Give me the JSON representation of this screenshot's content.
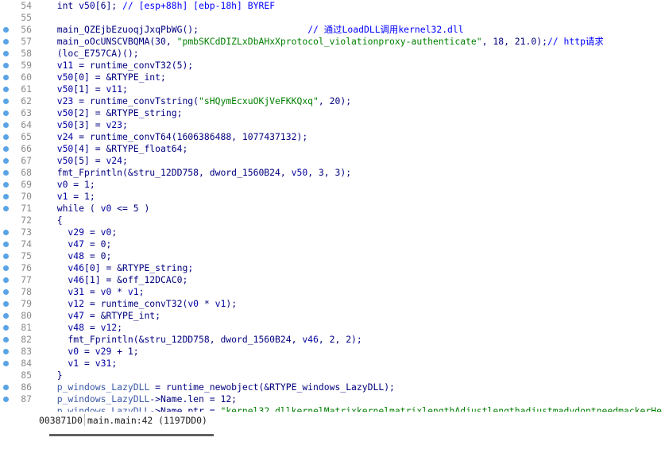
{
  "status_bar": {
    "address": "003871D0",
    "location": "main.main:42 (1197DD0)"
  },
  "colors": {
    "breakpoint": "#5aa4e6",
    "keyword": "#00007f",
    "comment": "#0000ff",
    "string": "#007f00",
    "line_number": "#8a8a8a"
  },
  "code_lines": [
    {
      "num": "54",
      "bp": false,
      "tokens": [
        [
          "kw",
          "  int "
        ],
        [
          "lvar",
          "v50"
        ],
        [
          "sym",
          "[6]; "
        ],
        [
          "cmt",
          "// [esp+88h] [ebp-18h] BYREF"
        ]
      ]
    },
    {
      "num": "55",
      "bp": false,
      "tokens": []
    },
    {
      "num": "56",
      "bp": true,
      "tokens": [
        [
          "fn",
          "  main_QZEjbEzuoqjJxqPbWG"
        ],
        [
          "sym",
          "();                    "
        ],
        [
          "cmt",
          "// 通过LoadDLL调用kernel32.dll"
        ]
      ]
    },
    {
      "num": "57",
      "bp": true,
      "tokens": [
        [
          "fn",
          "  main_oOcUNSCVBQMA"
        ],
        [
          "sym",
          "(30, "
        ],
        [
          "str",
          "\"pmbSKCdDIZLxDbAHxXprotocol_violationproxy-authenticate\""
        ],
        [
          "sym",
          ", 18, 21.0);"
        ],
        [
          "cmt",
          "// http请求"
        ]
      ]
    },
    {
      "num": "58",
      "bp": true,
      "tokens": [
        [
          "sym",
          "  (loc_E757CA)();"
        ]
      ]
    },
    {
      "num": "59",
      "bp": true,
      "tokens": [
        [
          "lvar",
          "  v11"
        ],
        [
          "sym",
          " = runtime_convT32(5);"
        ]
      ]
    },
    {
      "num": "60",
      "bp": true,
      "tokens": [
        [
          "lvar",
          "  v50"
        ],
        [
          "sym",
          "[0] = &RTYPE_int;"
        ]
      ]
    },
    {
      "num": "61",
      "bp": true,
      "tokens": [
        [
          "lvar",
          "  v50"
        ],
        [
          "sym",
          "[1] = "
        ],
        [
          "lvar",
          "v11"
        ],
        [
          "sym",
          ";"
        ]
      ]
    },
    {
      "num": "62",
      "bp": true,
      "tokens": [
        [
          "lvar",
          "  v23"
        ],
        [
          "sym",
          " = runtime_convTstring("
        ],
        [
          "str",
          "\"sHQymEcxuOKjVeFKKQxq\""
        ],
        [
          "sym",
          ", 20);"
        ]
      ]
    },
    {
      "num": "63",
      "bp": true,
      "tokens": [
        [
          "lvar",
          "  v50"
        ],
        [
          "sym",
          "[2] = &RTYPE_string;"
        ]
      ]
    },
    {
      "num": "64",
      "bp": true,
      "tokens": [
        [
          "lvar",
          "  v50"
        ],
        [
          "sym",
          "[3] = "
        ],
        [
          "lvar",
          "v23"
        ],
        [
          "sym",
          ";"
        ]
      ]
    },
    {
      "num": "65",
      "bp": true,
      "tokens": [
        [
          "lvar",
          "  v24"
        ],
        [
          "sym",
          " = runtime_convT64(1606386488, 1077437132);"
        ]
      ]
    },
    {
      "num": "66",
      "bp": true,
      "tokens": [
        [
          "lvar",
          "  v50"
        ],
        [
          "sym",
          "[4] = &RTYPE_float64;"
        ]
      ]
    },
    {
      "num": "67",
      "bp": true,
      "tokens": [
        [
          "lvar",
          "  v50"
        ],
        [
          "sym",
          "[5] = "
        ],
        [
          "lvar",
          "v24"
        ],
        [
          "sym",
          ";"
        ]
      ]
    },
    {
      "num": "68",
      "bp": true,
      "tokens": [
        [
          "sym",
          "  fmt_Fprintln(&stru_12DD758, dword_1560B24, "
        ],
        [
          "lvar",
          "v50"
        ],
        [
          "sym",
          ", 3, 3);"
        ]
      ]
    },
    {
      "num": "69",
      "bp": true,
      "tokens": [
        [
          "lvar",
          "  v0"
        ],
        [
          "sym",
          " = 1;"
        ]
      ]
    },
    {
      "num": "70",
      "bp": true,
      "tokens": [
        [
          "lvar",
          "  v1"
        ],
        [
          "sym",
          " = 1;"
        ]
      ]
    },
    {
      "num": "71",
      "bp": true,
      "tokens": [
        [
          "kw",
          "  while"
        ],
        [
          "sym",
          " ( "
        ],
        [
          "lvar",
          "v0"
        ],
        [
          "sym",
          " <= 5 )"
        ]
      ]
    },
    {
      "num": "72",
      "bp": false,
      "tokens": [
        [
          "sym",
          "  {"
        ]
      ]
    },
    {
      "num": "73",
      "bp": true,
      "tokens": [
        [
          "lvar",
          "    v29"
        ],
        [
          "sym",
          " = "
        ],
        [
          "lvar",
          "v0"
        ],
        [
          "sym",
          ";"
        ]
      ]
    },
    {
      "num": "74",
      "bp": true,
      "tokens": [
        [
          "lvar",
          "    v47"
        ],
        [
          "sym",
          " = 0;"
        ]
      ]
    },
    {
      "num": "75",
      "bp": true,
      "tokens": [
        [
          "lvar",
          "    v48"
        ],
        [
          "sym",
          " = 0;"
        ]
      ]
    },
    {
      "num": "76",
      "bp": true,
      "tokens": [
        [
          "lvar",
          "    v46"
        ],
        [
          "sym",
          "[0] = &RTYPE_string;"
        ]
      ]
    },
    {
      "num": "77",
      "bp": true,
      "tokens": [
        [
          "lvar",
          "    v46"
        ],
        [
          "sym",
          "[1] = &off_12DCAC0;"
        ]
      ]
    },
    {
      "num": "78",
      "bp": true,
      "tokens": [
        [
          "lvar",
          "    v31"
        ],
        [
          "sym",
          " = "
        ],
        [
          "lvar",
          "v0"
        ],
        [
          "sym",
          " * "
        ],
        [
          "lvar",
          "v1"
        ],
        [
          "sym",
          ";"
        ]
      ]
    },
    {
      "num": "79",
      "bp": true,
      "tokens": [
        [
          "lvar",
          "    v12"
        ],
        [
          "sym",
          " = runtime_convT32("
        ],
        [
          "lvar",
          "v0"
        ],
        [
          "sym",
          " * "
        ],
        [
          "lvar",
          "v1"
        ],
        [
          "sym",
          ");"
        ]
      ]
    },
    {
      "num": "80",
      "bp": true,
      "tokens": [
        [
          "lvar",
          "    v47"
        ],
        [
          "sym",
          " = &RTYPE_int;"
        ]
      ]
    },
    {
      "num": "81",
      "bp": true,
      "tokens": [
        [
          "lvar",
          "    v48"
        ],
        [
          "sym",
          " = "
        ],
        [
          "lvar",
          "v12"
        ],
        [
          "sym",
          ";"
        ]
      ]
    },
    {
      "num": "82",
      "bp": true,
      "tokens": [
        [
          "sym",
          "    fmt_Fprintln(&stru_12DD758, dword_1560B24, "
        ],
        [
          "lvar",
          "v46"
        ],
        [
          "sym",
          ", 2, 2);"
        ]
      ]
    },
    {
      "num": "83",
      "bp": true,
      "tokens": [
        [
          "lvar",
          "    v0"
        ],
        [
          "sym",
          " = "
        ],
        [
          "lvar",
          "v29"
        ],
        [
          "sym",
          " + 1;"
        ]
      ]
    },
    {
      "num": "84",
      "bp": true,
      "tokens": [
        [
          "lvar",
          "    v1"
        ],
        [
          "sym",
          " = "
        ],
        [
          "lvar",
          "v31"
        ],
        [
          "sym",
          ";"
        ]
      ]
    },
    {
      "num": "85",
      "bp": false,
      "tokens": [
        [
          "sym",
          "  }"
        ]
      ]
    },
    {
      "num": "86",
      "bp": true,
      "tokens": [
        [
          "gvar",
          "  p_windows_LazyDLL"
        ],
        [
          "sym",
          " = runtime_newobject(&RTYPE_windows_LazyDLL);"
        ]
      ]
    },
    {
      "num": "87",
      "bp": true,
      "tokens": [
        [
          "gvar",
          "  p_windows_LazyDLL"
        ],
        [
          "sym",
          "->Name.len = 12;"
        ]
      ]
    },
    {
      "num": "",
      "bp": false,
      "tokens": [
        [
          "gvar",
          "  p_windows_LazyDLL"
        ],
        [
          "sym",
          "->Name.ptr = "
        ],
        [
          "str",
          "\"kernel32.dllkernelMatrixkernelmatrixlengthAdjustlengthadjustmadydontneedmackerHe"
        ]
      ]
    }
  ]
}
